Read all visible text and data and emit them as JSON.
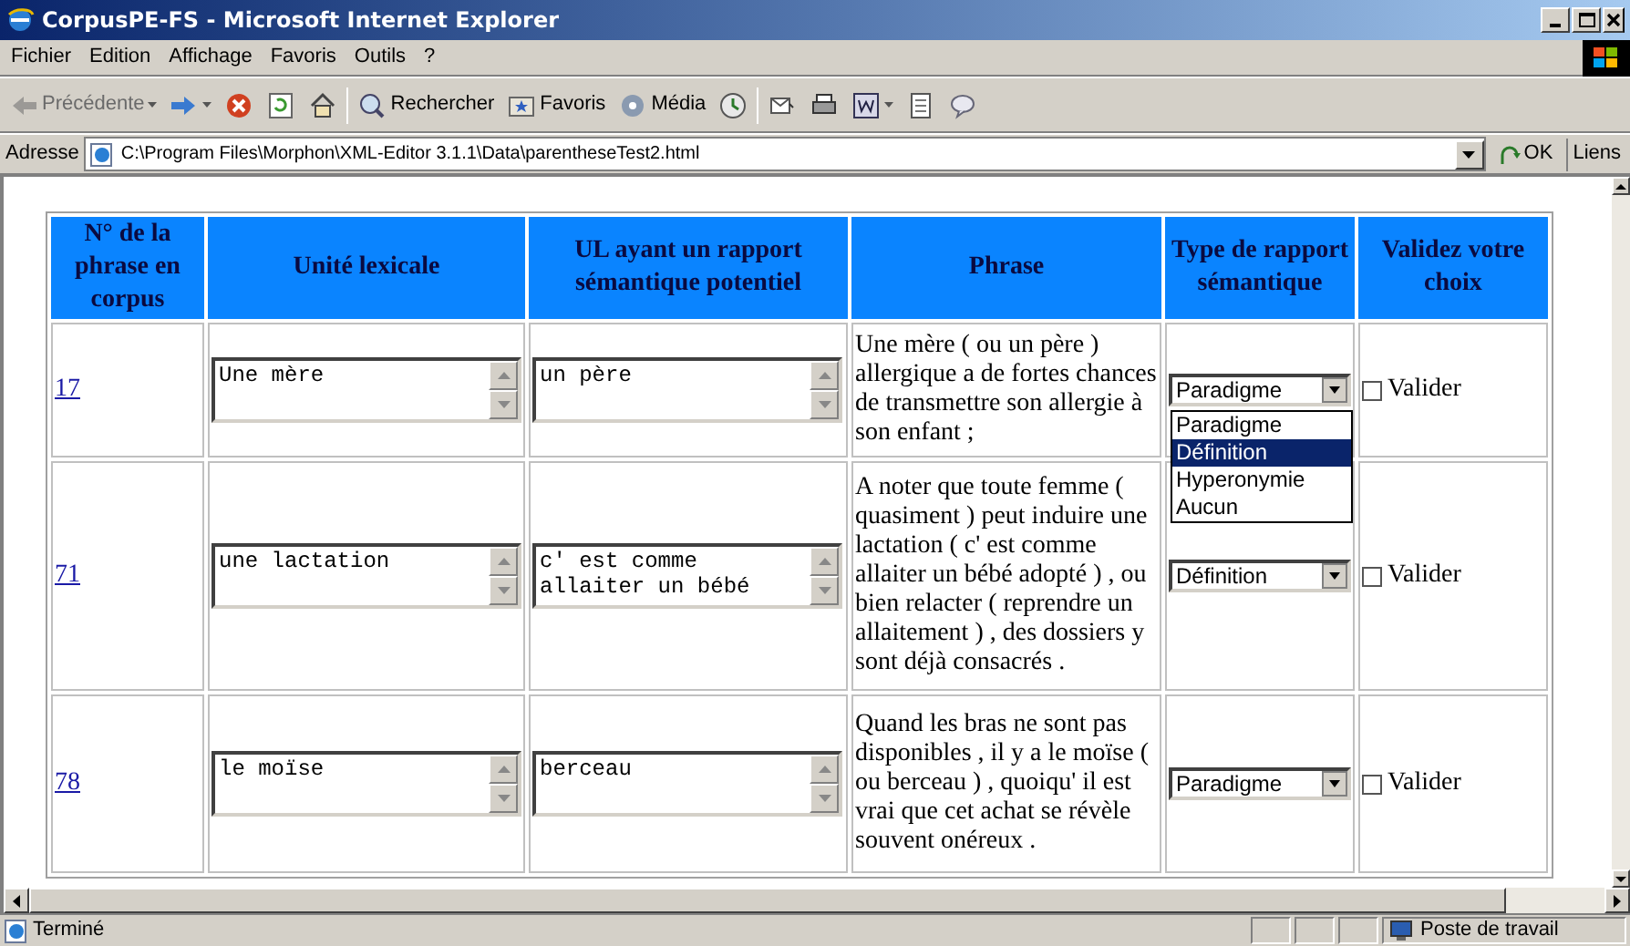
{
  "window": {
    "title": "CorpusPE-FS - Microsoft Internet Explorer"
  },
  "menu": [
    {
      "label": "Fichier"
    },
    {
      "label": "Edition"
    },
    {
      "label": "Affichage"
    },
    {
      "label": "Favoris"
    },
    {
      "label": "Outils"
    },
    {
      "label": "?"
    }
  ],
  "toolbar": [
    {
      "kind": "back",
      "label": "Précédente",
      "disabled": true
    },
    {
      "kind": "forward",
      "disabled": false
    },
    {
      "kind": "stop",
      "disabled": false
    },
    {
      "kind": "refresh",
      "disabled": false
    },
    {
      "kind": "home",
      "disabled": false
    },
    {
      "kind": "search",
      "label": "Rechercher",
      "disabled": false
    },
    {
      "kind": "favorites",
      "label": "Favoris",
      "disabled": false
    },
    {
      "kind": "media",
      "label": "Média",
      "disabled": false
    },
    {
      "kind": "history",
      "disabled": false
    },
    {
      "kind": "mail",
      "disabled": false
    },
    {
      "kind": "print",
      "disabled": false
    },
    {
      "kind": "word",
      "disabled": false
    },
    {
      "kind": "note",
      "disabled": false
    },
    {
      "kind": "messenger",
      "disabled": false
    }
  ],
  "address": {
    "label": "Adresse",
    "url": "C:\\Program Files\\Morphon\\XML-Editor 3.1.1\\Data\\parentheseTest2.html",
    "go": "OK",
    "links": "Liens"
  },
  "table": {
    "columns": [
      "N° de la phrase en corpus",
      "Unité lexicale",
      "UL ayant un rapport sémantique potentiel",
      "Phrase",
      "Type de rapport sémantique",
      "Validez votre choix"
    ],
    "rows": [
      {
        "number": "17",
        "unit": "Une mère",
        "related": "un père",
        "phrase": "Une mère ( ou un père ) allergique a de fortes chances de transmettre son allergie à son enfant ;",
        "relation": "Paradigme",
        "validate": {
          "label": "Valider",
          "checked": false
        },
        "open_list": [
          {
            "label": "Paradigme",
            "selected": false
          },
          {
            "label": "Définition",
            "selected": true
          },
          {
            "label": "Hyperonymie",
            "selected": false
          },
          {
            "label": "Aucun",
            "selected": false
          }
        ]
      },
      {
        "number": "71",
        "unit": "une lactation",
        "related": "c' est comme allaiter un bébé",
        "phrase": "A noter que toute femme ( quasiment ) peut induire une lactation ( c' est comme allaiter un bébé adopté ) , ou bien relacter ( reprendre un allaitement ) , des dossiers y sont déjà consacrés .",
        "relation": "Définition",
        "validate": {
          "label": "Valider",
          "checked": false
        }
      },
      {
        "number": "78",
        "unit": "le moïse",
        "related": "berceau",
        "phrase": "Quand les bras ne sont pas disponibles , il y a le moïse ( ou berceau ) , quoiqu' il est vrai que cet achat se révèle souvent onéreux .",
        "relation": "Paradigme",
        "validate": {
          "label": "Valider",
          "checked": false
        }
      }
    ]
  },
  "status_bar": {
    "text": "Terminé",
    "zone": "Poste de travail"
  }
}
